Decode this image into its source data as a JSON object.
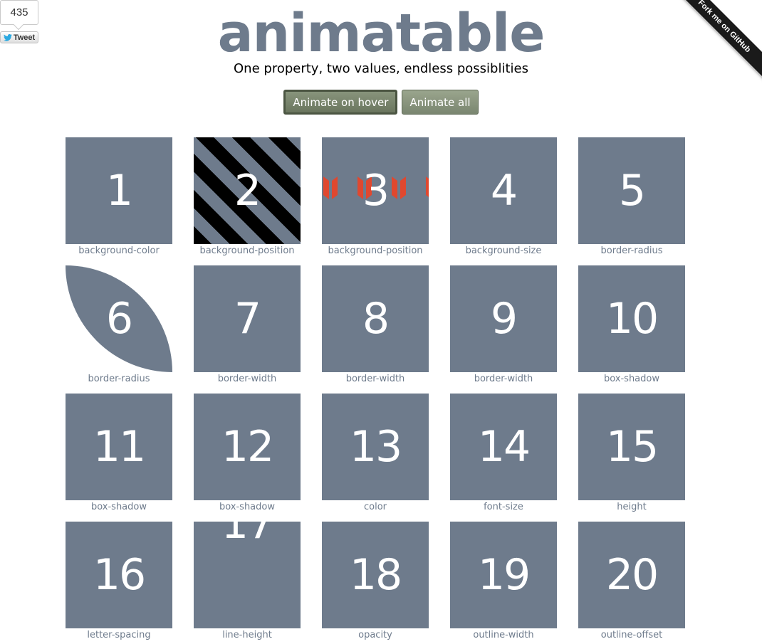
{
  "tweet": {
    "count": "435",
    "label": "Tweet"
  },
  "ribbon": {
    "label": "Fork me on GitHub"
  },
  "header": {
    "title": "animatable",
    "subtitle": "One property, two values, endless possiblities"
  },
  "buttons": {
    "hover": "Animate on hover",
    "all": "Animate all"
  },
  "colors": {
    "box": "#6e7b8c",
    "button": "#8a9680",
    "accent_red": "#e0482f"
  },
  "items": [
    {
      "num": "1",
      "label": "background-color"
    },
    {
      "num": "2",
      "label": "background-position"
    },
    {
      "num": "3",
      "label": "background-position"
    },
    {
      "num": "4",
      "label": "background-size"
    },
    {
      "num": "5",
      "label": "border-radius"
    },
    {
      "num": "6",
      "label": "border-radius"
    },
    {
      "num": "7",
      "label": "border-width"
    },
    {
      "num": "8",
      "label": "border-width"
    },
    {
      "num": "9",
      "label": "border-width"
    },
    {
      "num": "10",
      "label": "box-shadow"
    },
    {
      "num": "11",
      "label": "box-shadow"
    },
    {
      "num": "12",
      "label": "box-shadow"
    },
    {
      "num": "13",
      "label": "color"
    },
    {
      "num": "14",
      "label": "font-size"
    },
    {
      "num": "15",
      "label": "height"
    },
    {
      "num": "16",
      "label": "letter-spacing"
    },
    {
      "num": "17",
      "label": "line-height"
    },
    {
      "num": "18",
      "label": "opacity"
    },
    {
      "num": "19",
      "label": "outline-width"
    },
    {
      "num": "20",
      "label": "outline-offset"
    }
  ]
}
